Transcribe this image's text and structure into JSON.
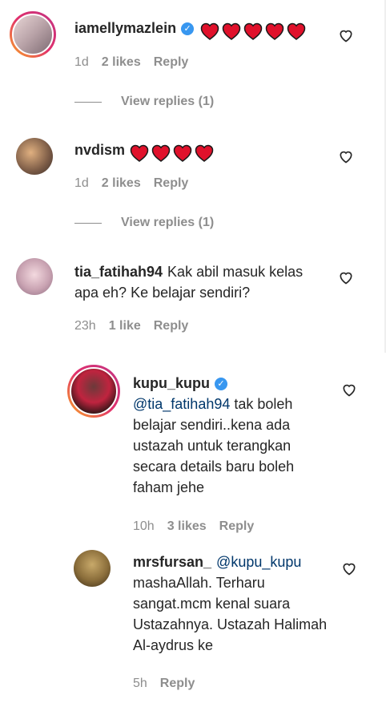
{
  "comments": [
    {
      "username": "iamellymazlein",
      "verified": true,
      "text": "",
      "hearts": 5,
      "time": "1d",
      "likes": "2 likes",
      "reply": "Reply",
      "view_replies": "View replies (1)"
    },
    {
      "username": "nvdism",
      "verified": false,
      "text": "",
      "hearts": 4,
      "time": "1d",
      "likes": "2 likes",
      "reply": "Reply",
      "view_replies": "View replies (1)"
    },
    {
      "username": "tia_fatihah94",
      "verified": false,
      "text": "Kak abil masuk kelas apa eh? Ke belajar sendiri?",
      "time": "23h",
      "likes": "1 like",
      "reply": "Reply"
    }
  ],
  "replies": [
    {
      "username": "kupu_kupu",
      "verified": true,
      "mention": "@tia_fatihah94",
      "text": "tak boleh belajar sendiri..kena ada ustazah untuk terangkan secara details baru boleh faham jehe",
      "time": "10h",
      "likes": "3 likes",
      "reply": "Reply"
    },
    {
      "username": "mrsfursan_",
      "verified": false,
      "mention": "@kupu_kupu",
      "text": "mashaAllah. Terharu sangat.mcm kenal suara Ustazahnya. Ustazah Halimah Al-aydrus ke",
      "time": "5h",
      "reply": "Reply"
    }
  ],
  "colors": {
    "heart_emoji": "#e0112b",
    "verified": "#3897f0",
    "mention": "#00376b",
    "meta": "#8e8e8e"
  }
}
